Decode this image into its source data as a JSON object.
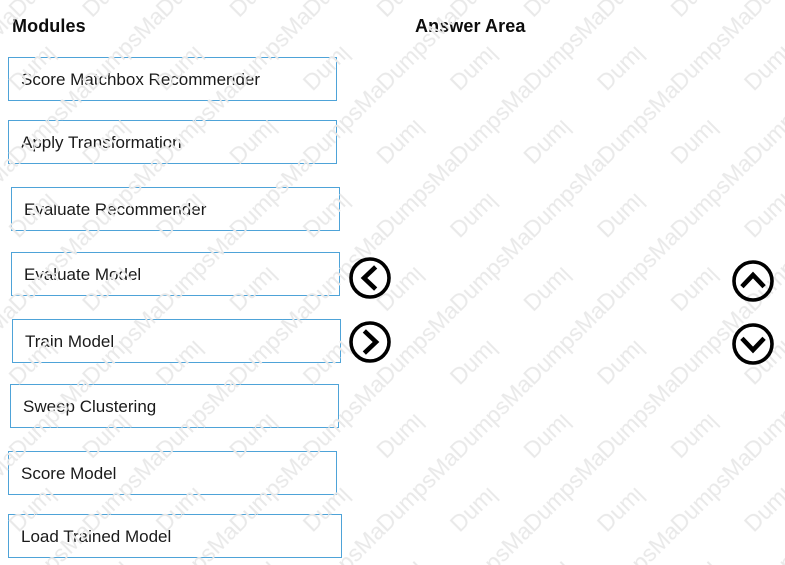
{
  "page": {
    "background_color": "#ffffff",
    "watermark_text": "DumpsMate",
    "watermark_color": "#e9e9e9"
  },
  "colors": {
    "box_border": "#4ea3d8",
    "box_fill": "#ffffff",
    "text": "#1a1a1a",
    "heading": "#0d0d0d",
    "arrow_stroke": "#000000"
  },
  "modules_panel": {
    "heading": "Modules",
    "items": [
      {
        "label": "Score Matchbox Recommender"
      },
      {
        "label": "Apply Transformation"
      },
      {
        "label": "Evaluate Recommender"
      },
      {
        "label": "Evaluate Model"
      },
      {
        "label": "Train Model"
      },
      {
        "label": "Sweep Clustering"
      },
      {
        "label": "Score Model"
      },
      {
        "label": "Load Trained Model"
      }
    ]
  },
  "answer_panel": {
    "heading": "Answer Area",
    "items": []
  },
  "transfer_controls": {
    "move_left": {
      "icon": "chevron-left-circle-icon",
      "label": ""
    },
    "move_right": {
      "icon": "chevron-right-circle-icon",
      "label": ""
    }
  },
  "order_controls": {
    "move_up": {
      "icon": "chevron-up-circle-icon",
      "label": ""
    },
    "move_down": {
      "icon": "chevron-down-circle-icon",
      "label": ""
    }
  }
}
